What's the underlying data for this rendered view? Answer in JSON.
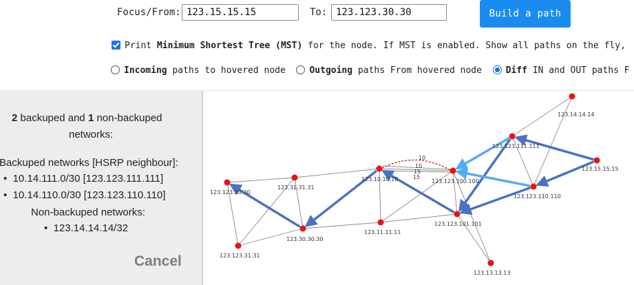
{
  "header": {
    "focus_label": "Focus/From:",
    "focus_value": "123.15.15.15",
    "to_label": "To:",
    "to_value": "123.123.30.30",
    "build_button": "Build a path"
  },
  "mst_option": {
    "checked": true,
    "prefix": "Print ",
    "bold": "Minimum Shortest Tree (MST)",
    "suffix": " for the node. If MST is enabled. Show all paths on the fly,"
  },
  "direction_options": [
    {
      "bold": "Incoming",
      "rest": " paths to hovered node",
      "selected": false
    },
    {
      "bold": "Outgoing",
      "rest": " paths From hovered node",
      "selected": false
    },
    {
      "bold": "Diff",
      "rest": " IN and OUT paths F",
      "selected": true
    }
  ],
  "panel": {
    "summary_count_backup": "2",
    "summary_mid": " backuped and ",
    "summary_count_nonbackup": "1",
    "summary_end": " non-backuped",
    "summary_line2": "networks:",
    "backuped_title": "Backuped networks [HSRP neighbour]:",
    "backuped": [
      "10.14.111.0/30 [123.123.111.111]",
      "10.14.110.0/30 [123.123.110.110]"
    ],
    "nonbackuped_title": "Non-backuped networks:",
    "nonbackuped": [
      "123.14.14.14/32"
    ],
    "cancel": "Cancel"
  },
  "colors": {
    "accent": "#1a8cf0",
    "node": "#ee1111",
    "path_main": "#4a72c4",
    "path_light": "#55aaf5",
    "backup_net": "#1f8a1f",
    "nonbackup_net": "#e01010"
  },
  "graph": {
    "nodes": [
      {
        "id": "123.14.14.14"
      },
      {
        "id": "123.123.111.111"
      },
      {
        "id": "123.15.15.15"
      },
      {
        "id": "123.123.110.110"
      },
      {
        "id": "123.123.100.100"
      },
      {
        "id": "123.10.10.10"
      },
      {
        "id": "123.123.30.30"
      },
      {
        "id": "123.31.31.31"
      },
      {
        "id": "123.30.30.30"
      },
      {
        "id": "123.123.31.31"
      },
      {
        "id": "123.11.11.11"
      },
      {
        "id": "123.123.101.101"
      },
      {
        "id": "123.13.13.13"
      }
    ],
    "edge_labels": [
      "10",
      "10",
      "15",
      "15"
    ]
  }
}
